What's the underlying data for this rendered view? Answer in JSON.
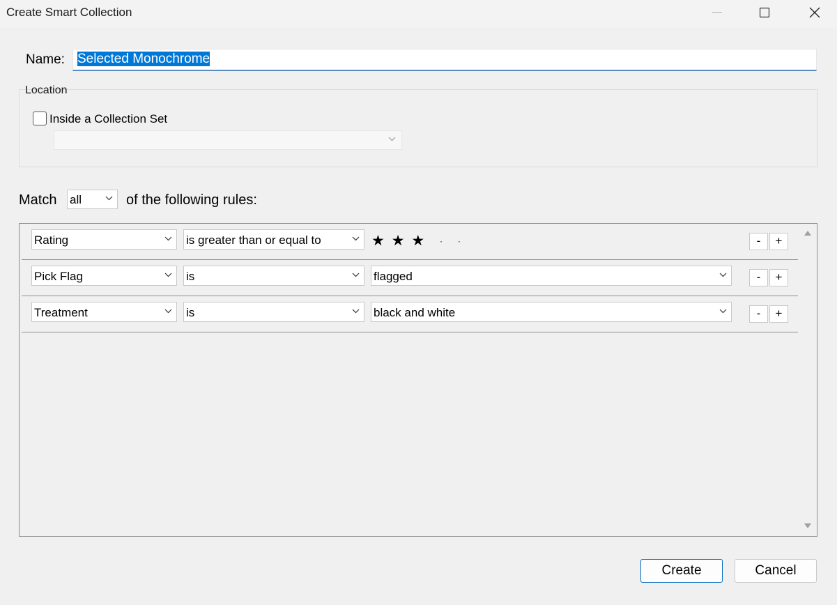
{
  "window": {
    "title": "Create Smart Collection"
  },
  "name": {
    "label": "Name:",
    "value": "Selected Monochrome"
  },
  "location": {
    "legend": "Location",
    "checkbox_label": "Inside a Collection Set",
    "checked": false,
    "set_value": ""
  },
  "match": {
    "label": "Match",
    "value": "all",
    "tail": "of the following rules:"
  },
  "rules": [
    {
      "field": "Rating",
      "operator": "is greater than or equal to",
      "value": "",
      "stars": 3,
      "max_stars": 5
    },
    {
      "field": "Pick Flag",
      "operator": "is",
      "value": "flagged"
    },
    {
      "field": "Treatment",
      "operator": "is",
      "value": "black and white"
    }
  ],
  "row_buttons": {
    "remove": "-",
    "add": "+"
  },
  "buttons": {
    "create": "Create",
    "cancel": "Cancel"
  },
  "icons": {
    "minimize": "minimize-icon",
    "maximize": "maximize-icon",
    "close": "close-icon",
    "dropdown": "chevron-down-icon",
    "star_filled": "★",
    "star_empty": "·"
  },
  "colors": {
    "selection": "#0078d7",
    "primary_border": "#0067c0"
  }
}
